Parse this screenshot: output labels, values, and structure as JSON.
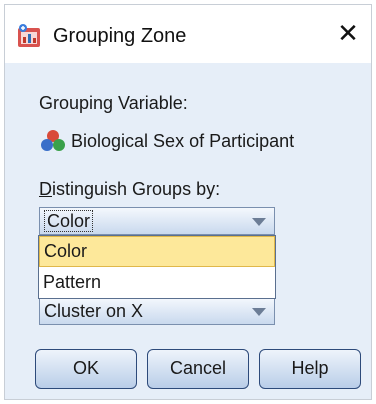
{
  "window": {
    "title": "Grouping Zone",
    "icon": "chart-app-icon",
    "close_glyph": "✕"
  },
  "grouping_variable": {
    "label": "Grouping Variable:",
    "icon": "nominal-variable-icon",
    "name": "Biological Sex of Participant"
  },
  "distinguish": {
    "label_underlined": "D",
    "label_rest": "istinguish Groups by:",
    "selected_value": "Color",
    "options": [
      "Color",
      "Pattern"
    ],
    "highlighted_option": "Color"
  },
  "cluster_select": {
    "value": "Cluster on X"
  },
  "buttons": {
    "ok": "OK",
    "cancel": "Cancel",
    "help": "Help"
  }
}
